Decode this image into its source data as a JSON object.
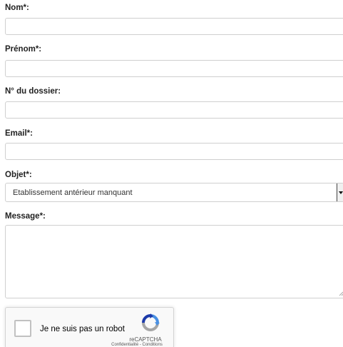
{
  "form": {
    "nom_label": "Nom*:",
    "prenom_label": "Prénom*:",
    "dossier_label": "N° du dossier:",
    "email_label": "Email*:",
    "objet_label": "Objet*:",
    "objet_value": "Etablissement antérieur manquant",
    "message_label": "Message*:"
  },
  "recaptcha": {
    "label": "Je ne suis pas un robot",
    "brand": "reCAPTCHA",
    "links": "Confidentialité - Conditions"
  },
  "colors": {
    "field_border": "#cfcfcf",
    "recaptcha_blue": "#4a90e2",
    "recaptcha_darkblue": "#1c3aa9",
    "recaptcha_grey": "#a6a6a6"
  },
  "icons": {
    "dropdown": "chevron-down-icon",
    "recaptcha": "recaptcha-logo-icon",
    "resize": "resize-grip-icon"
  }
}
